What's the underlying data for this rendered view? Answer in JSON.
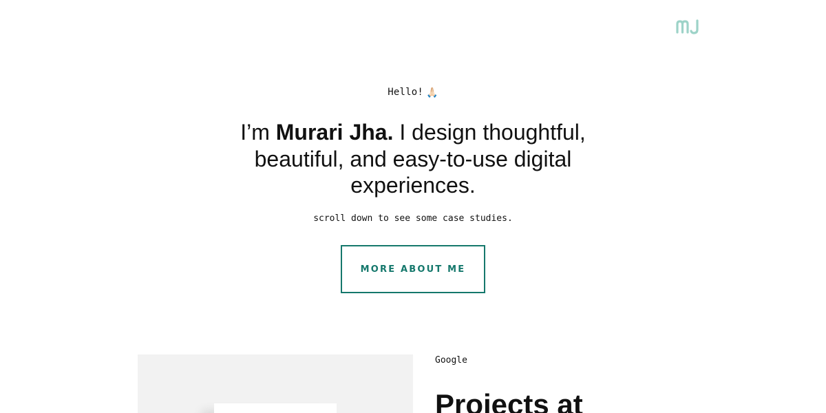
{
  "header": {
    "logo_text": "MJ",
    "logo_color": "#9dd3c8"
  },
  "hero": {
    "greeting": "Hello!",
    "greeting_emoji": "🙏🏻",
    "headline_prefix": "I’m ",
    "headline_name": "Murari Jha.",
    "headline_rest": " I design thoughtful, beautiful, and easy-to-use digital experiences.",
    "subline": "scroll down to see some case studies.",
    "cta_label": "MORE ABOUT ME"
  },
  "case_study": {
    "kicker": "Google",
    "title": "Projects at"
  },
  "colors": {
    "accent": "#15786c",
    "image_background": "#f2f2f2",
    "text": "#111111"
  }
}
